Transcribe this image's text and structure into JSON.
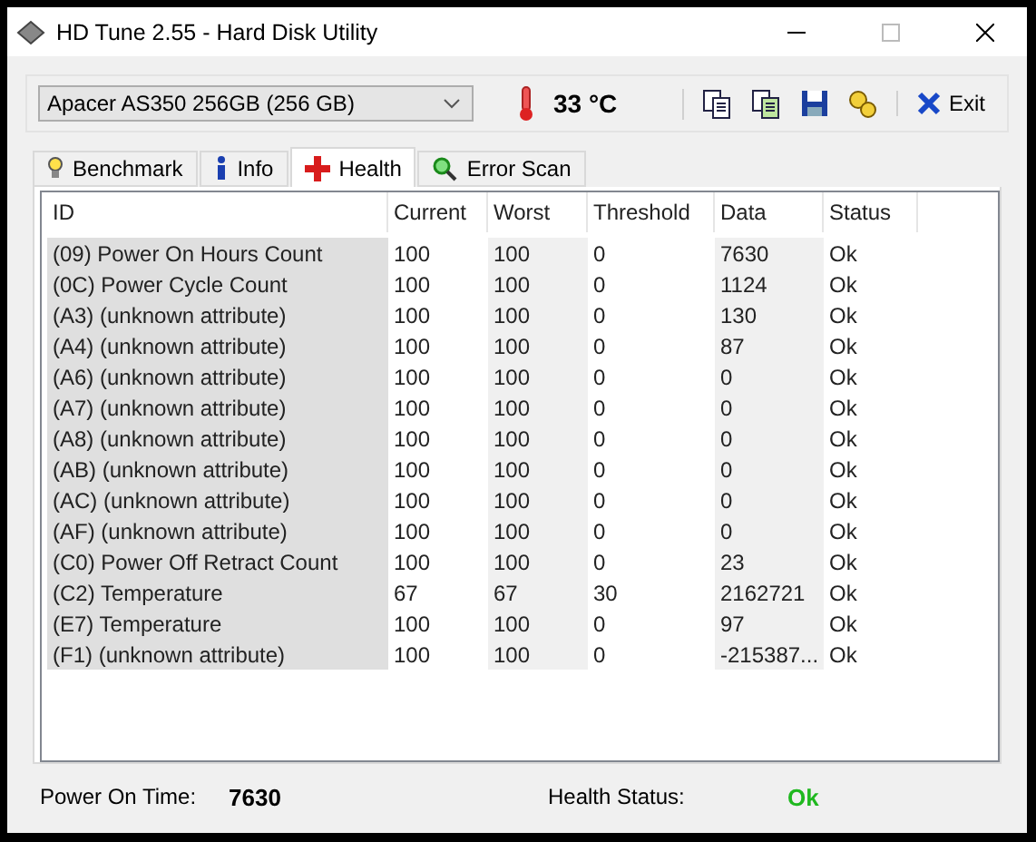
{
  "window": {
    "title": "HD Tune 2.55 - Hard Disk Utility"
  },
  "toolbar": {
    "drive": "Apacer  AS350 256GB (256 GB)",
    "temperature": "33 °C",
    "exit": "Exit"
  },
  "tabs": [
    {
      "label": "Benchmark",
      "kind": "benchmark",
      "selected": false
    },
    {
      "label": "Info",
      "kind": "info",
      "selected": false
    },
    {
      "label": "Health",
      "kind": "health",
      "selected": true
    },
    {
      "label": "Error Scan",
      "kind": "scan",
      "selected": false
    }
  ],
  "table": {
    "columns": [
      "ID",
      "Current",
      "Worst",
      "Threshold",
      "Data",
      "Status"
    ],
    "rows": [
      [
        "(09) Power On Hours Count",
        "100",
        "100",
        "0",
        "7630",
        "Ok"
      ],
      [
        "(0C) Power Cycle Count",
        "100",
        "100",
        "0",
        "1124",
        "Ok"
      ],
      [
        "(A3) (unknown attribute)",
        "100",
        "100",
        "0",
        "130",
        "Ok"
      ],
      [
        "(A4) (unknown attribute)",
        "100",
        "100",
        "0",
        "87",
        "Ok"
      ],
      [
        "(A6) (unknown attribute)",
        "100",
        "100",
        "0",
        "0",
        "Ok"
      ],
      [
        "(A7) (unknown attribute)",
        "100",
        "100",
        "0",
        "0",
        "Ok"
      ],
      [
        "(A8) (unknown attribute)",
        "100",
        "100",
        "0",
        "0",
        "Ok"
      ],
      [
        "(AB) (unknown attribute)",
        "100",
        "100",
        "0",
        "0",
        "Ok"
      ],
      [
        "(AC) (unknown attribute)",
        "100",
        "100",
        "0",
        "0",
        "Ok"
      ],
      [
        "(AF) (unknown attribute)",
        "100",
        "100",
        "0",
        "0",
        "Ok"
      ],
      [
        "(C0) Power Off Retract Count",
        "100",
        "100",
        "0",
        "23",
        "Ok"
      ],
      [
        "(C2) Temperature",
        "67",
        "67",
        "30",
        "2162721",
        "Ok"
      ],
      [
        "(E7) Temperature",
        "100",
        "100",
        "0",
        "97",
        "Ok"
      ],
      [
        "(F1) (unknown attribute)",
        "100",
        "100",
        "0",
        "-215387...",
        "Ok"
      ]
    ]
  },
  "footer": {
    "power_on_label": "Power On Time:",
    "power_on_value": "7630",
    "health_label": "Health Status:",
    "health_value": "Ok"
  }
}
